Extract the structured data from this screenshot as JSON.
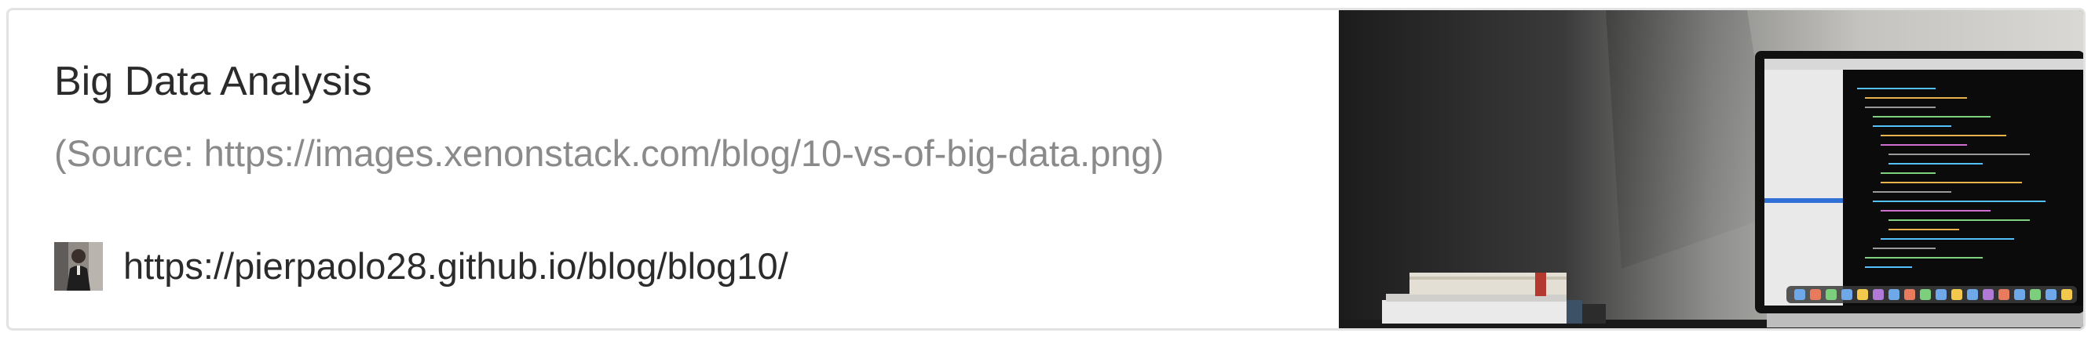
{
  "card": {
    "title": "Big Data Analysis",
    "description": "(Source: https://images.xenonstack.com/blog/10-vs-of-big-data.png)",
    "url": "https://pierpaolo28.github.io/blog/blog10/",
    "favicon_icon": "author-avatar-icon",
    "thumbnail_icon": "laptop-on-desk-photo"
  },
  "colors": {
    "title": "#2b2b2b",
    "description": "#8a8a8a",
    "border": "#e3e3e3"
  }
}
